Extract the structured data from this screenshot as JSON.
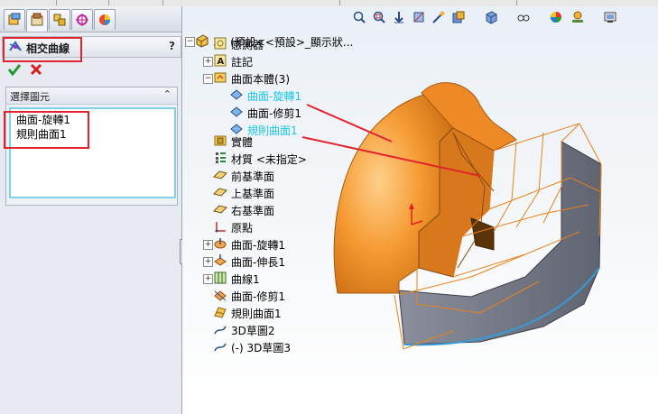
{
  "property_manager": {
    "title": "相交曲線",
    "help": "?",
    "selection_group": {
      "label": "選擇圖元",
      "items": [
        "曲面-旋轉1",
        "規則曲面1"
      ]
    }
  },
  "feature_tree": {
    "root": "30 (預設<<預設>_顯示狀...",
    "nodes": [
      {
        "label": "感測器",
        "icon": "sensor-icon"
      },
      {
        "label": "註記",
        "icon": "annotation-icon"
      },
      {
        "label": "曲面本體(3)",
        "icon": "surface-bodies-folder-icon"
      },
      {
        "label": "曲面-旋轉1",
        "icon": "surface-body-icon",
        "highlighted": true
      },
      {
        "label": "曲面-修剪1",
        "icon": "surface-body-icon"
      },
      {
        "label": "規則曲面1",
        "icon": "surface-body-icon",
        "highlighted": true
      },
      {
        "label": "實體",
        "icon": "solid-bodies-folder-icon"
      },
      {
        "label": "材質 <未指定>",
        "icon": "material-icon"
      },
      {
        "label": "前基準面",
        "icon": "plane-icon"
      },
      {
        "label": "上基準面",
        "icon": "plane-icon"
      },
      {
        "label": "右基準面",
        "icon": "plane-icon"
      },
      {
        "label": "原點",
        "icon": "origin-icon"
      },
      {
        "label": "曲面-旋轉1",
        "icon": "revolve-surface-icon"
      },
      {
        "label": "曲面-伸長1",
        "icon": "extrude-surface-icon"
      },
      {
        "label": "曲線1",
        "icon": "curve-icon"
      },
      {
        "label": "曲面-修剪1",
        "icon": "trim-surface-icon"
      },
      {
        "label": "規則曲面1",
        "icon": "ruled-surface-icon"
      },
      {
        "label": "3D草圖2",
        "icon": "3d-sketch-icon"
      },
      {
        "label": "(-) 3D草圖3",
        "icon": "3d-sketch-icon"
      }
    ],
    "sketch_badge": "3D"
  },
  "colors": {
    "accent_highlight": "#19c6ea",
    "model_orange": "#f0902a",
    "model_gray": "#6f7480",
    "annotation_red": "#e3232e"
  },
  "toolbar_icons": [
    "zoom-to-fit-icon",
    "zoom-area-icon",
    "previous-view-icon",
    "section-view-icon",
    "dynamic-annotation-icon",
    "view-orientation-icon",
    "display-style-icon",
    "hide-show-icon",
    "edit-appearance-icon",
    "apply-scene-icon",
    "view-settings-icon"
  ]
}
